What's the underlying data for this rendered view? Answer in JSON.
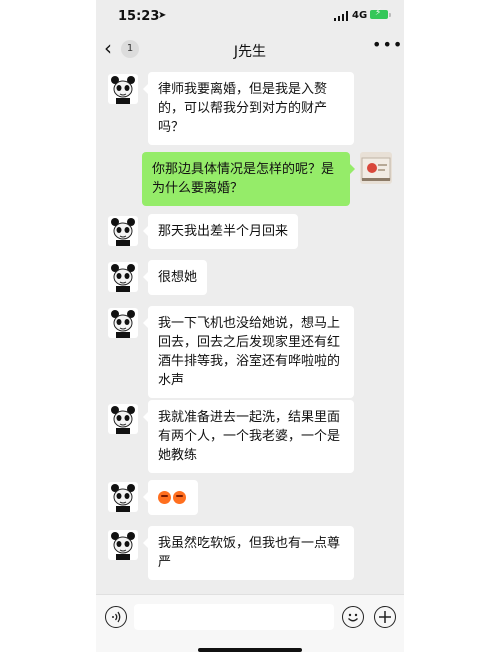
{
  "status_bar": {
    "time": "15:23",
    "network": "4G",
    "icons": [
      "location-arrow-icon",
      "signal-bars-icon",
      "battery-charging-icon"
    ]
  },
  "nav": {
    "back_icon": "‹",
    "unread_count": "1",
    "title": "J先生",
    "more_icon": "•••"
  },
  "messages": [
    {
      "side": "left",
      "text": "律师我要离婚，但是我是入赘的，可以帮我分到对方的财产吗？"
    },
    {
      "side": "right",
      "text": "你那边具体情况是怎样的呢？是为什么要离婚？"
    },
    {
      "side": "left",
      "text": "那天我出差半个月回来"
    },
    {
      "side": "left",
      "text": "很想她"
    },
    {
      "side": "left",
      "text": "我一下飞机也没给她说，想马上回去，回去之后发现家里还有红酒牛排等我，浴室还有哗啦啦的水声"
    },
    {
      "side": "left",
      "text": "我就准备进去一起洗，结果里面有两个人，一个我老婆，一个是她教练"
    },
    {
      "side": "left",
      "emoji": [
        "angry-face-icon",
        "angry-face-icon"
      ]
    },
    {
      "side": "left",
      "text": "我虽然吃软饭，但我也有一点尊严"
    }
  ],
  "input_bar": {
    "voice_icon": "voice-icon",
    "value": "",
    "emoji_icon": "smiley-icon",
    "plus_icon": "plus-icon"
  },
  "colors": {
    "background": "#ededed",
    "bubble_self": "#95ec69",
    "bubble_other": "#ffffff",
    "battery": "#34c759"
  }
}
